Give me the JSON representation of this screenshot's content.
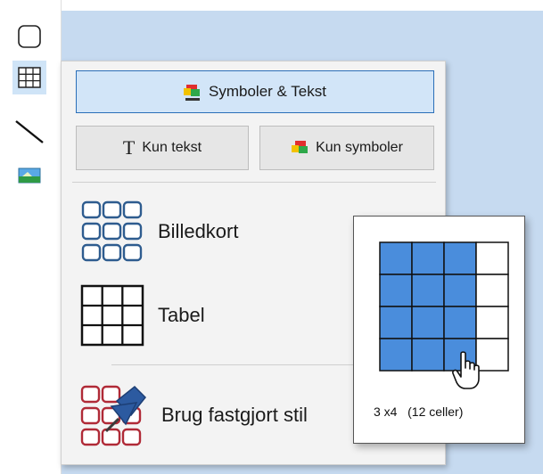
{
  "menu": {
    "symbols_text_label": "Symboler & Tekst",
    "text_only_label": "Kun tekst",
    "text_only_glyph": "T",
    "symbols_only_label": "Kun symboler",
    "items": [
      {
        "label": "Billedkort",
        "icon": "picture-cards-icon"
      },
      {
        "label": "Tabel",
        "icon": "table-grid-icon"
      },
      {
        "label": "Brug fastgjort stil",
        "icon": "pinned-style-icon"
      }
    ]
  },
  "grid_picker": {
    "rows": 4,
    "cols": 4,
    "selected_rows": 4,
    "selected_cols": 3,
    "label": "3 x4   (12 celler)"
  },
  "colors": {
    "selected_cell": "#4a8ddc",
    "panel_bg": "#f3f3f3",
    "primary_button_bg": "#d2e5f8",
    "primary_button_border": "#2b6fb8",
    "canvas_bg": "#c6daf0"
  }
}
